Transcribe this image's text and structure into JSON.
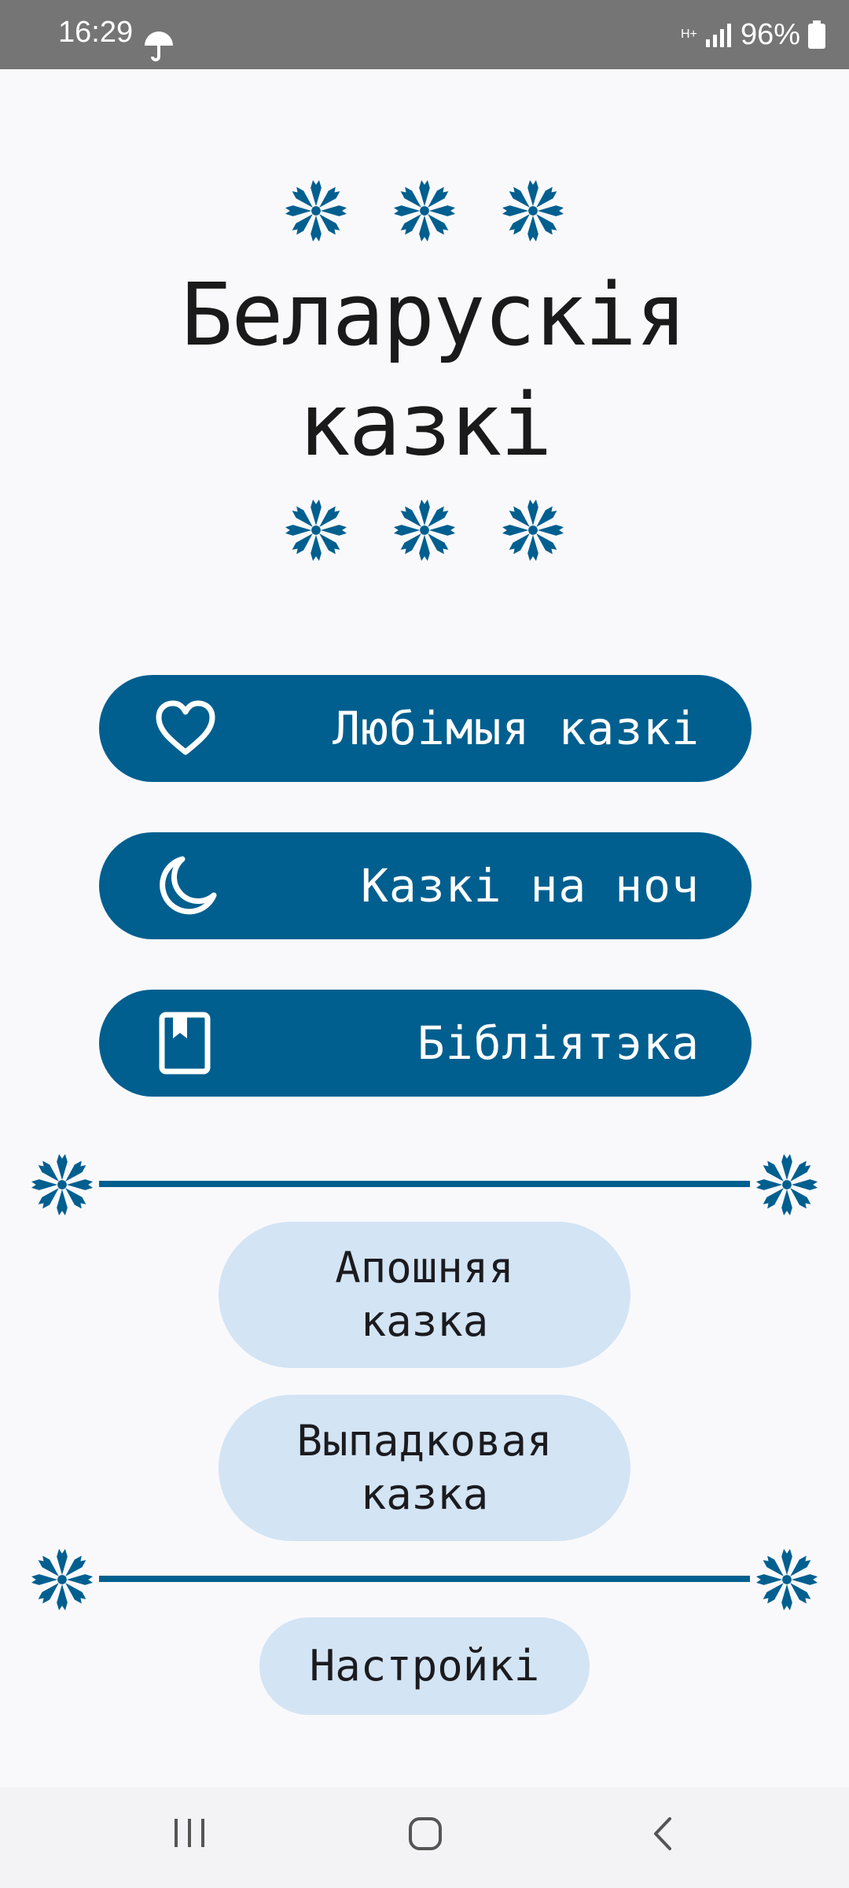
{
  "status_bar": {
    "time": "16:29",
    "network": "H+",
    "battery": "96%"
  },
  "app": {
    "title": "Беларускія казкі"
  },
  "menu": {
    "favorites_label": "Любімыя казкі",
    "bedtime_label": "Казкі на ноч",
    "library_label": "Бібліятэка"
  },
  "secondary": {
    "last_tale_label": "Апошняя казка",
    "random_tale_label": "Выпадковая казка"
  },
  "settings": {
    "label": "Настройкі"
  },
  "colors": {
    "primary": "#005f8f",
    "pill": "#d3e4f4",
    "background": "#f9f9fc",
    "status_bar": "#757575"
  },
  "icons": {
    "decor": "cornflower-icon",
    "favorites": "heart-icon",
    "bedtime": "moon-icon",
    "library": "book-icon"
  }
}
